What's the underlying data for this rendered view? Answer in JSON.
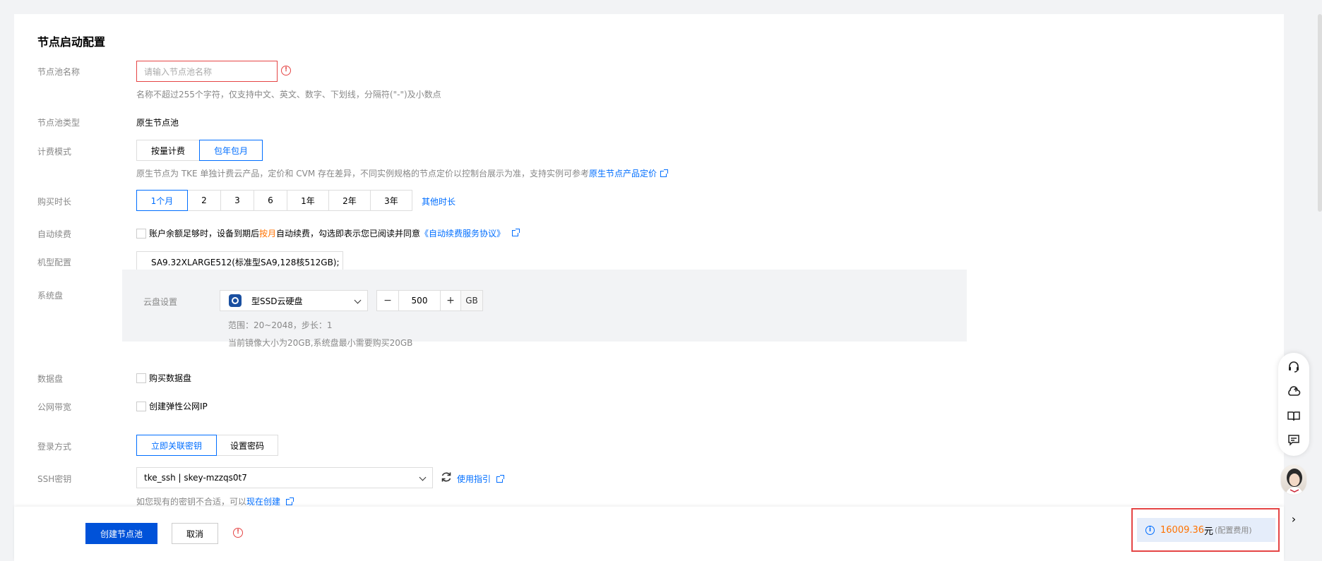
{
  "section_title": "节点启动配置",
  "pool_name": {
    "label": "节点池名称",
    "placeholder": "请输入节点池名称",
    "error_icon": "!",
    "hint": "名称不超过255个字符，仅支持中文、英文、数字、下划线，分隔符(\"-\")及小数点"
  },
  "pool_type": {
    "label": "节点池类型",
    "value": "原生节点池"
  },
  "billing": {
    "label": "计费模式",
    "options": [
      "按量计费",
      "包年包月"
    ],
    "selected": "包年包月",
    "note_prefix": "原生节点为 TKE 单独计费云产品，定价和 CVM 存在差异，不同实例规格的节点定价以控制台展示为准，支持实例可参考",
    "note_link": "原生节点产品定价"
  },
  "duration": {
    "label": "购买时长",
    "options": [
      "1个月",
      "2",
      "3",
      "6",
      "1年",
      "2年",
      "3年"
    ],
    "selected": "1个月",
    "other_link": "其他时长"
  },
  "auto_renew": {
    "label": "自动续费",
    "text_prefix": "账户余额足够时，设备到期后",
    "text_highlight": "按月",
    "text_suffix": "自动续费，勾选即表示您已阅读并同意",
    "agreement_link": "《自动续费服务协议》"
  },
  "instance_type": {
    "label": "机型配置",
    "value": "SA9.32XLARGE512(标准型SA9,128核512GB);"
  },
  "system_disk": {
    "label": "系统盘",
    "cloud_disk_label": "云盘设置",
    "disk_type": "型SSD云硬盘",
    "size": "500",
    "unit": "GB",
    "minus": "−",
    "plus": "+",
    "range_hint": "范围：20~2048，步长：1",
    "image_hint": "当前镜像大小为20GB,系统盘最小需要购买20GB"
  },
  "data_disk": {
    "label": "数据盘",
    "checkbox_label": "购买数据盘"
  },
  "public_bandwidth": {
    "label": "公网带宽",
    "checkbox_label": "创建弹性公网IP"
  },
  "login": {
    "label": "登录方式",
    "options": [
      "立即关联密钥",
      "设置密码"
    ],
    "selected": "立即关联密钥"
  },
  "ssh_key": {
    "label": "SSH密钥",
    "value": "tke_ssh | skey-mzzqs0t7",
    "guide_link": "使用指引",
    "hint_prefix": "如您现有的密钥不合适，可以",
    "hint_link": "现在创建"
  },
  "footer": {
    "create_button": "创建节点池",
    "cancel_button": "取消",
    "error_icon": "!",
    "price_info_icon": "i",
    "price_amount": "16009.36",
    "price_unit": "元",
    "price_note": "(配置费用)",
    "collapse_icon": "›"
  },
  "colors": {
    "primary": "#0052d9",
    "link": "#006eff",
    "error": "#e54545",
    "price": "#ff7200"
  }
}
